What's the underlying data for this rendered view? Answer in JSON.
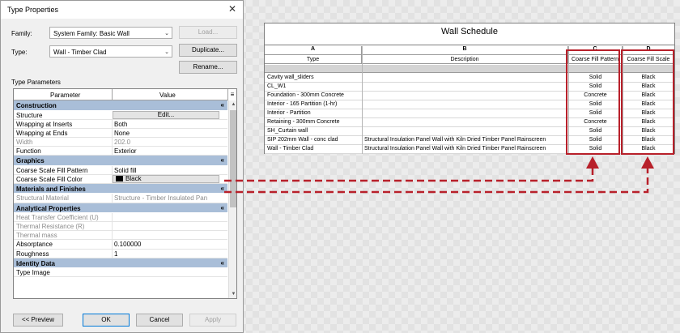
{
  "dialog": {
    "title": "Type Properties",
    "close_glyph": "✕",
    "family_label": "Family:",
    "family_value": "System Family: Basic Wall",
    "type_label": "Type:",
    "type_value": "Wall - Timber Clad",
    "load_label": "Load...",
    "duplicate_label": "Duplicate...",
    "rename_label": "Rename...",
    "type_parameters_label": "Type Parameters",
    "col_parameter": "Parameter",
    "col_value": "Value",
    "sort_glyph": "≡",
    "collapse_glyph": "«",
    "edit_label": "Edit...",
    "sections": {
      "construction": "Construction",
      "graphics": "Graphics",
      "materials": "Materials and Finishes",
      "analytical": "Analytical Properties",
      "identity": "Identity Data"
    },
    "rows": {
      "structure": {
        "p": "Structure",
        "v": ""
      },
      "wrap_inserts": {
        "p": "Wrapping at Inserts",
        "v": "Both"
      },
      "wrap_ends": {
        "p": "Wrapping at Ends",
        "v": "None"
      },
      "width": {
        "p": "Width",
        "v": "202.0"
      },
      "function": {
        "p": "Function",
        "v": "Exterior"
      },
      "fill_pattern": {
        "p": "Coarse Scale Fill Pattern",
        "v": "Solid fill"
      },
      "fill_color": {
        "p": "Coarse Scale Fill Color",
        "v": "Black"
      },
      "struct_material": {
        "p": "Structural Material",
        "v": "Structure - Timber Insulated Pan"
      },
      "heat_transfer": {
        "p": "Heat Transfer Coefficient (U)",
        "v": ""
      },
      "thermal_resistance": {
        "p": "Thermal Resistance (R)",
        "v": ""
      },
      "thermal_mass": {
        "p": "Thermal mass",
        "v": ""
      },
      "absorptance": {
        "p": "Absorptance",
        "v": "0.100000"
      },
      "roughness": {
        "p": "Roughness",
        "v": "1"
      },
      "type_image": {
        "p": "Type Image",
        "v": ""
      }
    },
    "preview_label": "<< Preview",
    "ok_label": "OK",
    "cancel_label": "Cancel",
    "apply_label": "Apply"
  },
  "schedule": {
    "title": "Wall Schedule",
    "col_letters": [
      "A",
      "B",
      "C",
      "D"
    ],
    "headers": [
      "Type",
      "Description",
      "Coarse Fill Pattern",
      "Coarse Fill Scale"
    ],
    "rows": [
      {
        "type": "Cavity wall_sliders",
        "desc": "",
        "pattern": "Solid",
        "scale": "Black"
      },
      {
        "type": "CL_W1",
        "desc": "",
        "pattern": "Solid",
        "scale": "Black"
      },
      {
        "type": "Foundation - 300mm Concrete",
        "desc": "",
        "pattern": "Concrete",
        "scale": "Black"
      },
      {
        "type": "Interior - 165 Partition (1-hr)",
        "desc": "",
        "pattern": "Solid",
        "scale": "Black"
      },
      {
        "type": "Interior - Partition",
        "desc": "",
        "pattern": "Solid",
        "scale": "Black"
      },
      {
        "type": "Retaining - 300mm Concrete",
        "desc": "",
        "pattern": "Concrete",
        "scale": "Black"
      },
      {
        "type": "SH_Curtain wall",
        "desc": "",
        "pattern": "Solid",
        "scale": "Black"
      },
      {
        "type": "SIP 202mm Wall - conc clad",
        "desc": "Structural Insulation Panel Wall with Kiln Dried Timber Panel Rainscreen",
        "pattern": "Solid",
        "scale": "Black"
      },
      {
        "type": "Wall - Timber Clad",
        "desc": "Structural Insulation Panel Wall with Kiln Dried Timber Panel Rainscreen",
        "pattern": "Solid",
        "scale": "Black"
      }
    ]
  },
  "colors": {
    "annotation_red": "#b8202a",
    "section_header": "#a9bed8"
  }
}
